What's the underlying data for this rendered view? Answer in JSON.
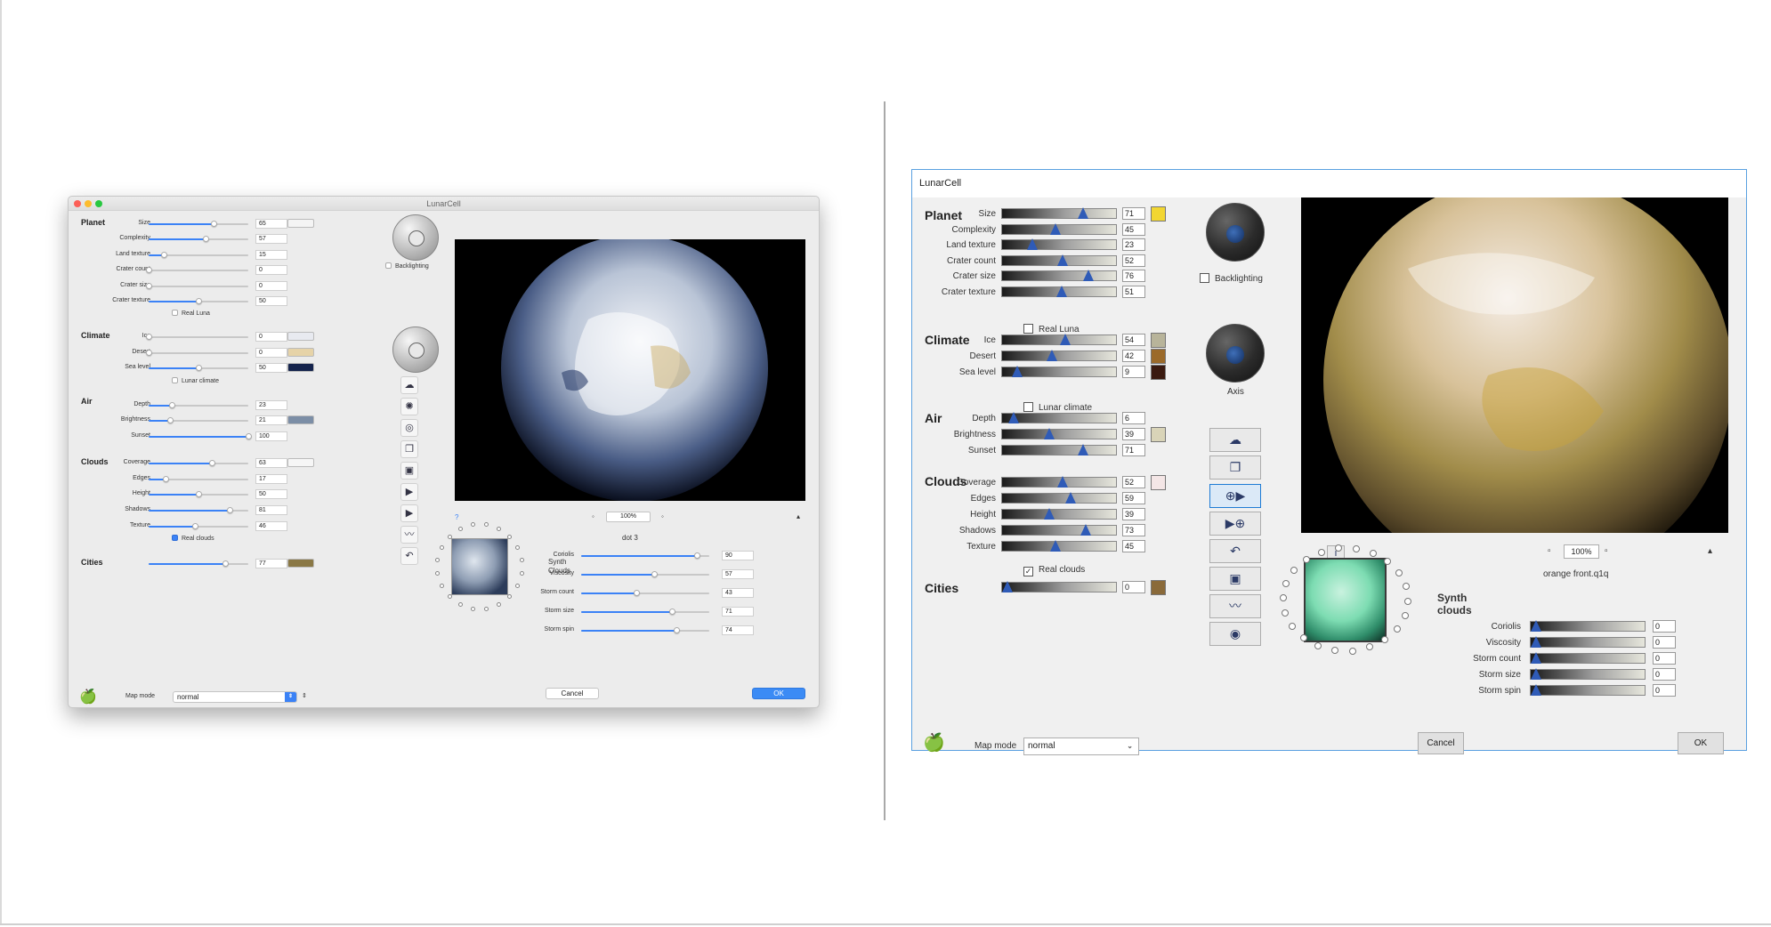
{
  "mac": {
    "title": "LunarCell",
    "traffic_colors": {
      "close": "#fc5f57",
      "minimize": "#fdbc2e",
      "zoom": "#28c840"
    },
    "sections": {
      "planet": "Planet",
      "climate": "Climate",
      "air": "Air",
      "clouds": "Clouds",
      "cities": "Cities"
    },
    "planet": [
      {
        "label": "Size",
        "value": "65",
        "pct": 0.65
      },
      {
        "label": "Complexity",
        "value": "57",
        "pct": 0.57
      },
      {
        "label": "Land texture",
        "value": "15",
        "pct": 0.15
      },
      {
        "label": "Crater count",
        "value": "0",
        "pct": 0
      },
      {
        "label": "Crater size",
        "value": "0",
        "pct": 0
      },
      {
        "label": "Crater texture",
        "value": "50",
        "pct": 0.5
      }
    ],
    "real_luna": "Real Luna",
    "climate": [
      {
        "label": "Ice",
        "value": "0",
        "pct": 0
      },
      {
        "label": "Desert",
        "value": "0",
        "pct": 0
      },
      {
        "label": "Sea level",
        "value": "50",
        "pct": 0.5
      }
    ],
    "lunar_climate": "Lunar climate",
    "air": [
      {
        "label": "Depth",
        "value": "23",
        "pct": 0.23
      },
      {
        "label": "Brightness",
        "value": "21",
        "pct": 0.21
      },
      {
        "label": "Sunset",
        "value": "100",
        "pct": 1.0
      }
    ],
    "clouds": [
      {
        "label": "Coverage",
        "value": "63",
        "pct": 0.63
      },
      {
        "label": "Edges",
        "value": "17",
        "pct": 0.17
      },
      {
        "label": "Height",
        "value": "50",
        "pct": 0.5
      },
      {
        "label": "Shadows",
        "value": "81",
        "pct": 0.81
      },
      {
        "label": "Texture",
        "value": "46",
        "pct": 0.46
      }
    ],
    "real_clouds": "Real clouds",
    "cities": {
      "value": "77",
      "pct": 0.77
    },
    "backlighting": "Backlighting",
    "map_mode_label": "Map mode",
    "map_mode_value": "normal",
    "zoom": "100%",
    "preset_name": "dot 3",
    "synth_clouds_label": "Synth Clouds",
    "synth": [
      {
        "label": "Coriolis",
        "value": "90",
        "pct": 0.9
      },
      {
        "label": "Viscosity",
        "value": "57",
        "pct": 0.57
      },
      {
        "label": "Storm count",
        "value": "43",
        "pct": 0.43
      },
      {
        "label": "Storm size",
        "value": "71",
        "pct": 0.71
      },
      {
        "label": "Storm spin",
        "value": "74",
        "pct": 0.74
      }
    ],
    "help": "?",
    "cancel": "Cancel",
    "ok": "OK",
    "swatches": {
      "planet": "#f4f4f4",
      "ice": "#e8eaf0",
      "desert": "#e6d3a8",
      "sea": "#15244d",
      "air": "#7c8ea6",
      "clouds": "#f6f6f6",
      "cities": "#8a7845"
    }
  },
  "win": {
    "title": "LunarCell",
    "sections": {
      "planet": "Planet",
      "climate": "Climate",
      "air": "Air",
      "clouds": "Clouds",
      "cities": "Cities"
    },
    "planet": [
      {
        "label": "Size",
        "value": "71",
        "pct": 0.71
      },
      {
        "label": "Complexity",
        "value": "45",
        "pct": 0.45
      },
      {
        "label": "Land texture",
        "value": "23",
        "pct": 0.23
      },
      {
        "label": "Crater count",
        "value": "52",
        "pct": 0.52
      },
      {
        "label": "Crater size",
        "value": "76",
        "pct": 0.76
      },
      {
        "label": "Crater texture",
        "value": "51",
        "pct": 0.51
      }
    ],
    "real_luna": "Real Luna",
    "climate": [
      {
        "label": "Ice",
        "value": "54",
        "pct": 0.54
      },
      {
        "label": "Desert",
        "value": "42",
        "pct": 0.42
      },
      {
        "label": "Sea level",
        "value": "9",
        "pct": 0.09
      }
    ],
    "lunar_climate": "Lunar climate",
    "air": [
      {
        "label": "Depth",
        "value": "6",
        "pct": 0.06
      },
      {
        "label": "Brightness",
        "value": "39",
        "pct": 0.39
      },
      {
        "label": "Sunset",
        "value": "71",
        "pct": 0.71
      }
    ],
    "clouds": [
      {
        "label": "Coverage",
        "value": "52",
        "pct": 0.52
      },
      {
        "label": "Edges",
        "value": "59",
        "pct": 0.59
      },
      {
        "label": "Height",
        "value": "39",
        "pct": 0.39
      },
      {
        "label": "Shadows",
        "value": "73",
        "pct": 0.73
      },
      {
        "label": "Texture",
        "value": "45",
        "pct": 0.45
      }
    ],
    "real_clouds": "Real clouds",
    "cities": {
      "value": "0",
      "pct": 0
    },
    "backlighting": "Backlighting",
    "axis": "Axis",
    "map_mode_label": "Map mode",
    "map_mode_value": "normal",
    "zoom": "100%",
    "preset_name": "orange front.q1q",
    "synth_clouds_label": "Synth clouds",
    "synth": [
      {
        "label": "Coriolis",
        "value": "0",
        "pct": 0
      },
      {
        "label": "Viscosity",
        "value": "0",
        "pct": 0
      },
      {
        "label": "Storm count",
        "value": "0",
        "pct": 0
      },
      {
        "label": "Storm size",
        "value": "0",
        "pct": 0
      },
      {
        "label": "Storm spin",
        "value": "0",
        "pct": 0
      }
    ],
    "cancel": "Cancel",
    "ok": "OK",
    "swatches": {
      "planet": "#f2d632",
      "ice": "#b8b49a",
      "desert": "#9b6a2a",
      "sea": "#3a1a10",
      "air": "#d9d4b8",
      "clouds": "#f4e6e6",
      "cities": "#8a6a3a"
    }
  }
}
